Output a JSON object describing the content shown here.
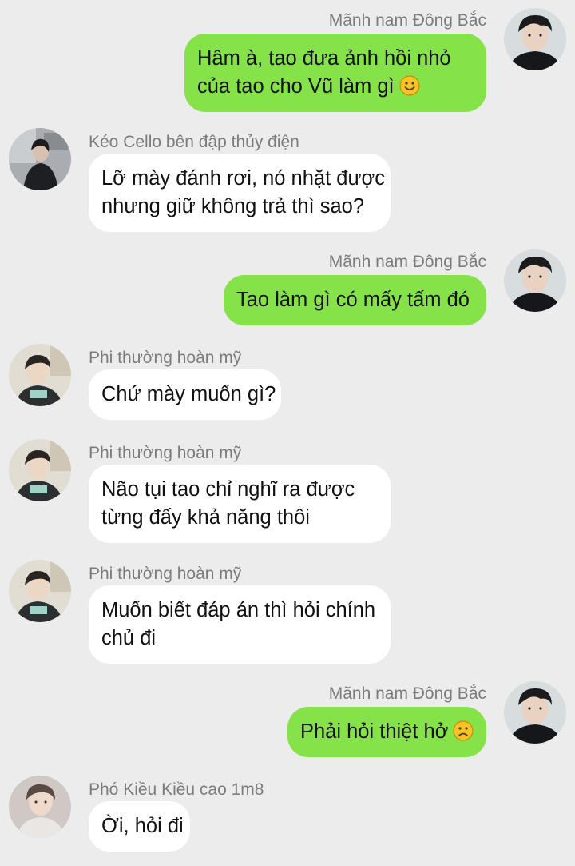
{
  "messages": [
    {
      "sender": "Mãnh nam Đông Bắc",
      "lines": [
        "Hâm à, tao đưa ảnh hồi nhỏ",
        "của tao cho Vũ làm gì"
      ],
      "emoji": "smiling-face-emoji",
      "avatar": "avatar-manh-nam-dong-bac"
    },
    {
      "sender": "Kéo Cello bên đập thủy điện",
      "lines": [
        "Lỡ mày đánh rơi, nó nhặt được",
        "nhưng giữ không trả thì sao?"
      ],
      "avatar": "avatar-keo-cello"
    },
    {
      "sender": "Mãnh nam Đông Bắc",
      "lines": [
        "Tao làm gì có mấy tấm đó"
      ],
      "avatar": "avatar-manh-nam-dong-bac"
    },
    {
      "sender": "Phi thường hoàn mỹ",
      "lines": [
        "Chứ mày muốn gì?"
      ],
      "avatar": "avatar-phi-thuong-hoan-my"
    },
    {
      "sender": "Phi thường hoàn mỹ",
      "lines": [
        "Não tụi tao chỉ nghĩ ra được",
        "từng đấy khả năng thôi"
      ],
      "avatar": "avatar-phi-thuong-hoan-my"
    },
    {
      "sender": "Phi thường hoàn mỹ",
      "lines": [
        "Muốn biết đáp án thì hỏi chính",
        "chủ đi"
      ],
      "avatar": "avatar-phi-thuong-hoan-my"
    },
    {
      "sender": "Mãnh nam Đông Bắc",
      "lines": [
        "Phải hỏi thiệt hở"
      ],
      "emoji": "frowning-face-emoji",
      "avatar": "avatar-manh-nam-dong-bac"
    },
    {
      "sender": "Phó Kiều Kiều cao 1m8",
      "lines": [
        "Ời, hỏi đi"
      ],
      "avatar": "avatar-pho-kieu-kieu"
    }
  ],
  "colors": {
    "background": "#ececec",
    "outgoing_bubble": "#85e249",
    "incoming_bubble": "#ffffff",
    "sender_text": "#7c7c7c",
    "message_text": "#111111"
  }
}
